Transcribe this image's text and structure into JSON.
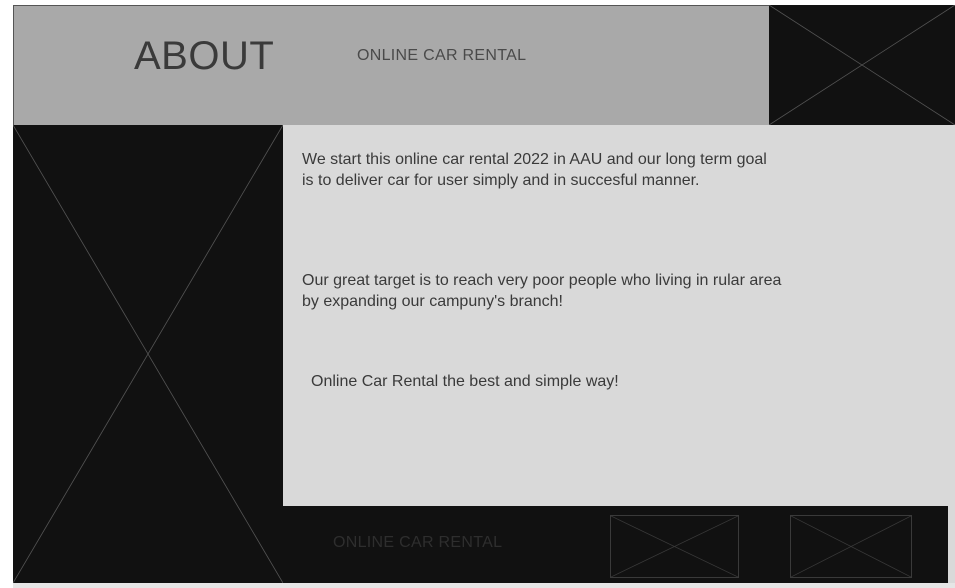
{
  "header": {
    "title": "ABOUT",
    "brand": "ONLINE CAR RENTAL"
  },
  "content": {
    "paragraphs": [
      "We start this online car rental 2022 in AAU and our long term goal is to deliver car for user simply and in succesful manner.",
      "Our great target is to reach very poor people who living in rular area by expanding our campuny's branch!",
      "Online Car Rental the best and simple way!"
    ]
  },
  "footer": {
    "brand": "ONLINE CAR RENTAL"
  },
  "colors": {
    "header_bg": "#a9a9a9",
    "content_bg": "#d9d9d9",
    "placeholder_bg": "#111111",
    "text": "#3a3a3a"
  },
  "icons": {
    "image_placeholder": "image-placeholder-icon"
  }
}
